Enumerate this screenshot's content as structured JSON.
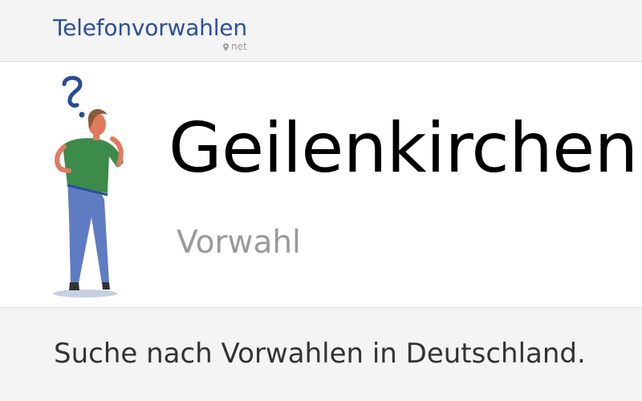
{
  "header": {
    "logo_text": "Telefonvorwahlen",
    "logo_suffix": "net",
    "logo_color": "#2c4f9e"
  },
  "hero": {
    "title": "Geilenkirchen",
    "subtitle": "Vorwahl",
    "illustration": "thinking-person-question-mark"
  },
  "footer": {
    "tagline": "Suche nach Vorwahlen in Deutschland."
  }
}
